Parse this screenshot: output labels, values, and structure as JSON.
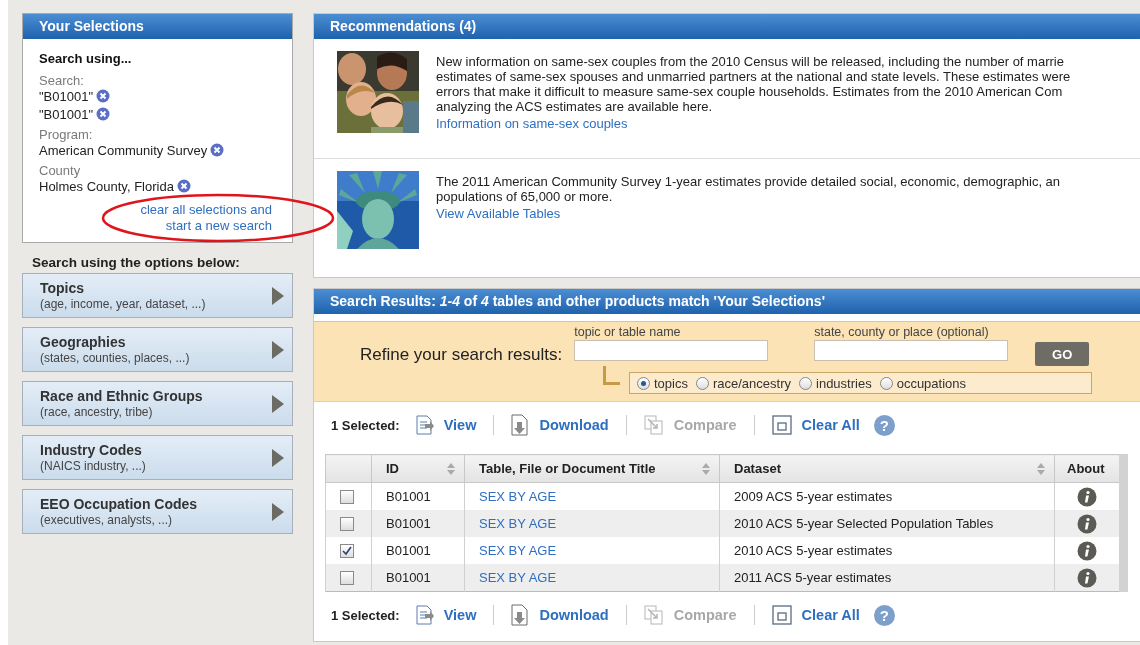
{
  "selections": {
    "title": "Your Selections",
    "heading": "Search using...",
    "groups": [
      {
        "label": "Search:",
        "values": [
          "\"B01001\"",
          "\"B01001\""
        ]
      },
      {
        "label": "Program:",
        "values": [
          "American Community Survey"
        ]
      },
      {
        "label": "County",
        "values": [
          "Holmes County, Florida"
        ]
      }
    ],
    "clear_link": [
      "clear all selections and",
      "start a new search"
    ]
  },
  "options": {
    "heading": "Search using the options below:",
    "items": [
      {
        "title": "Topics",
        "hint": "(age, income, year, dataset, ...)"
      },
      {
        "title": "Geographies",
        "hint": "(states, counties, places, ...)"
      },
      {
        "title": "Race and Ethnic Groups",
        "hint": "(race, ancestry, tribe)"
      },
      {
        "title": "Industry Codes",
        "hint": "(NAICS industry, ...)"
      },
      {
        "title": "EEO Occupation Codes",
        "hint": "(executives, analysts, ...)"
      }
    ]
  },
  "recommendations": {
    "title": "Recommendations (4)",
    "items": [
      {
        "kind": "children",
        "lines": [
          "New information on same-sex couples from the 2010 Census will be released, including the number of marrie",
          "estimates of same-sex spouses and unmarried partners at the national and state levels. These estimates were",
          "errors that make it difficult to measure same-sex couple households. Estimates from the 2010 American Com",
          "analyzing the ACS estimates are available here."
        ],
        "link": "Information on same-sex couples"
      },
      {
        "kind": "statue",
        "lines": [
          "The 2011 American Community Survey 1-year estimates provide detailed social, economic, demographic, an",
          "populations of 65,000 or more."
        ],
        "link": "View Available Tables"
      }
    ]
  },
  "results": {
    "title": "Search Results:  *1-4* of *4* tables and other products match 'Your Selections'",
    "refine": {
      "label": "Refine your search results:",
      "fields": [
        {
          "label": "topic or table name"
        },
        {
          "label": "state, county or place (optional)"
        }
      ],
      "go": "GO",
      "options": [
        {
          "label": "topics",
          "selected": true
        },
        {
          "label": "race/ancestry",
          "selected": false
        },
        {
          "label": "industries",
          "selected": false
        },
        {
          "label": "occupations",
          "selected": false
        }
      ]
    },
    "toolbars": [
      {
        "count": "1 Selected:",
        "actions": [
          {
            "kind": "view",
            "label": "View",
            "disabled": false
          },
          {
            "kind": "download",
            "label": "Download",
            "disabled": false
          },
          {
            "kind": "compare",
            "label": "Compare",
            "disabled": true
          },
          {
            "kind": "clear",
            "label": "Clear All",
            "disabled": false
          }
        ],
        "help": "?"
      },
      {
        "count": "1 Selected:",
        "actions": [
          {
            "kind": "view",
            "label": "View",
            "disabled": false
          },
          {
            "kind": "download",
            "label": "Download",
            "disabled": false
          },
          {
            "kind": "compare",
            "label": "Compare",
            "disabled": true
          },
          {
            "kind": "clear",
            "label": "Clear All",
            "disabled": false
          }
        ],
        "help": "?"
      }
    ],
    "table": {
      "columns": [
        {
          "label": "ID",
          "sortable": true
        },
        {
          "label": "Table, File or Document Title",
          "sortable": true
        },
        {
          "label": "Dataset",
          "sortable": true
        },
        {
          "label": "About",
          "sortable": false
        }
      ],
      "rows": [
        {
          "checked": false,
          "id": "B01001",
          "title": "SEX BY AGE",
          "dataset": "2009 ACS 5-year estimates"
        },
        {
          "checked": false,
          "id": "B01001",
          "title": "SEX BY AGE",
          "dataset": "2010 ACS 5-year Selected Population Tables"
        },
        {
          "checked": true,
          "id": "B01001",
          "title": "SEX BY AGE",
          "dataset": "2010 ACS 5-year estimates"
        },
        {
          "checked": false,
          "id": "B01001",
          "title": "SEX BY AGE",
          "dataset": "2011 ACS 5-year estimates"
        }
      ]
    }
  }
}
